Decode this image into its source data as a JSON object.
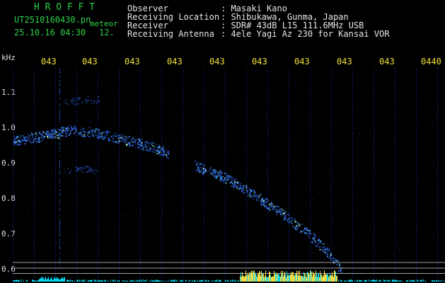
{
  "header": {
    "app_name": "H R O F F T",
    "filename": "UT2510160430.pn",
    "meteor_label": "meteor",
    "datetime": "25.10.16 04:30",
    "count": "12."
  },
  "info": [
    {
      "label": "Observer",
      "value": ": Masaki Kano"
    },
    {
      "label": "Receiving Location",
      "value": ": Shibukawa, Gunma, Japan"
    },
    {
      "label": "Receiver",
      "value": ": SDR# 43dB L15 111.6MHz USB"
    },
    {
      "label": "Receiving Antenna",
      "value": ": 4ele Yagi Az 230 for Kansai VOR"
    }
  ],
  "chart_data": {
    "type": "heatmap",
    "ylabel": "kHz",
    "x_ticks": [
      "043",
      "043",
      "043",
      "043",
      "043",
      "043",
      "043",
      "043",
      "043",
      "0440"
    ],
    "y_ticks": [
      "1.1",
      "1.0",
      "0.9",
      "0.8",
      "0.7",
      "0.6"
    ],
    "ylim": [
      0.58,
      1.2
    ],
    "colors": {
      "background": "#000000",
      "noise": "#1f2a8a",
      "signal_low": "#2b5fd8",
      "signal_mid": "#4aa8ff",
      "signal_high": "#b8ffd0",
      "grid": "#0a1a5a",
      "ref_line": "#bdbdbd",
      "green_text": "#2fd04a",
      "yellow_text": "#f2e03a",
      "spectrum_cyan": "#00e5ff",
      "spectrum_yellow": "#ffe84a"
    },
    "traces": [
      {
        "name": "",
        "points": [
          [
            0.0,
            0.965
          ],
          [
            0.08,
            0.98
          ],
          [
            0.13,
            0.995
          ],
          [
            0.2,
            0.985
          ],
          [
            0.3,
            0.955
          ],
          [
            0.36,
            0.93
          ]
        ]
      },
      {
        "name": "",
        "points": [
          [
            0.42,
            0.895
          ],
          [
            0.5,
            0.855
          ],
          [
            0.56,
            0.81
          ],
          [
            0.62,
            0.76
          ],
          [
            0.68,
            0.705
          ],
          [
            0.72,
            0.66
          ],
          [
            0.76,
            0.6
          ]
        ]
      },
      {
        "name": "",
        "points": [
          [
            0.12,
            0.88
          ],
          [
            0.18,
            0.885
          ],
          [
            0.2,
            0.88
          ]
        ]
      },
      {
        "name": "",
        "points": [
          [
            0.12,
            1.075
          ],
          [
            0.17,
            1.08
          ],
          [
            0.2,
            1.08
          ]
        ]
      }
    ],
    "ref_lines": [
      0.621,
      0.605,
      0.59
    ]
  }
}
